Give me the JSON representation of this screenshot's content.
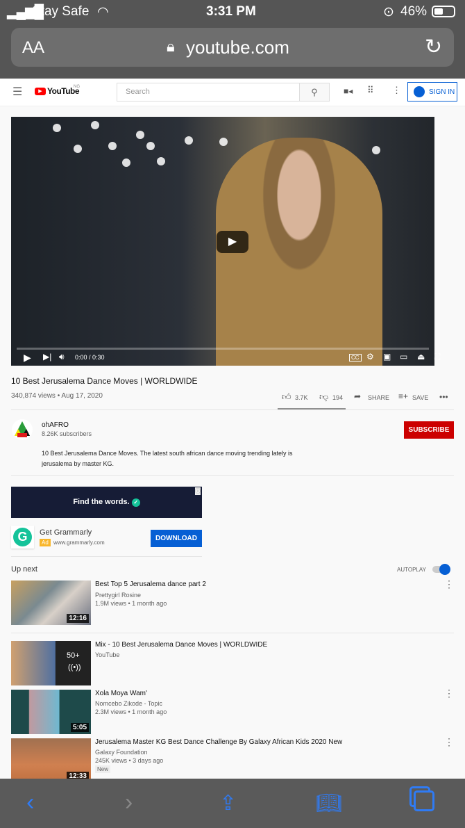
{
  "status_bar": {
    "carrier": "Stay Safe",
    "time": "3:31 PM",
    "battery": "46%",
    "battery_level": 46
  },
  "safari": {
    "text_size": "AA",
    "url": "youtube.com",
    "icons": [
      "lock-icon",
      "reload-icon",
      "back-icon",
      "forward-icon",
      "share-icon",
      "bookmarks-icon",
      "tabs-icon"
    ]
  },
  "header": {
    "logo": "YouTube",
    "region": "NG",
    "search_placeholder": "Search",
    "sign_in": "SIGN IN"
  },
  "player": {
    "time": "0:00 / 0:30",
    "progress": 0
  },
  "video": {
    "title": "10 Best Jerusalema Dance Moves | WORLDWIDE",
    "meta": "340,874 views • Aug 17, 2020",
    "likes": "3.7K",
    "dislikes": "194",
    "share": "SHARE",
    "save": "SAVE"
  },
  "channel": {
    "name": "ohAFRO",
    "subscribers": "8.26K subscribers",
    "subscribe": "SUBSCRIBE",
    "description": "10 Best Jerusalema Dance Moves. The latest south african dance moving trending lately is jerusalema by master KG."
  },
  "ad": {
    "banner": "Find the words.",
    "title": "Get Grammarly",
    "badge": "Ad",
    "url": "www.grammarly.com",
    "cta": "DOWNLOAD"
  },
  "up_next": {
    "label": "Up next",
    "autoplay": "AUTOPLAY",
    "autoplay_on": true,
    "items": [
      {
        "title": "Best Top 5 Jerusalema dance part 2",
        "channel": "Prettygirl Rosine",
        "meta": "1.9M views • 1 month ago",
        "duration": "12:16"
      },
      {
        "title": "Mix - 10 Best Jerusalema Dance Moves | WORLDWIDE",
        "channel": "YouTube",
        "count": "50+"
      },
      {
        "title": "Xola Moya Wam'",
        "channel": "Nomcebo Zikode - Topic",
        "meta": "2.3M views • 1 month ago",
        "duration": "5:05"
      },
      {
        "title": "Jerusalema Master KG Best Dance Challenge By Galaxy African Kids 2020 New",
        "channel": "Galaxy Foundation",
        "meta": "245K views • 3 days ago",
        "badge": "New",
        "duration": "12:33"
      }
    ]
  },
  "colors": {
    "accent": "#065fd4",
    "subscribe": "#cc0000",
    "safari_blue": "#2f7bf5"
  }
}
